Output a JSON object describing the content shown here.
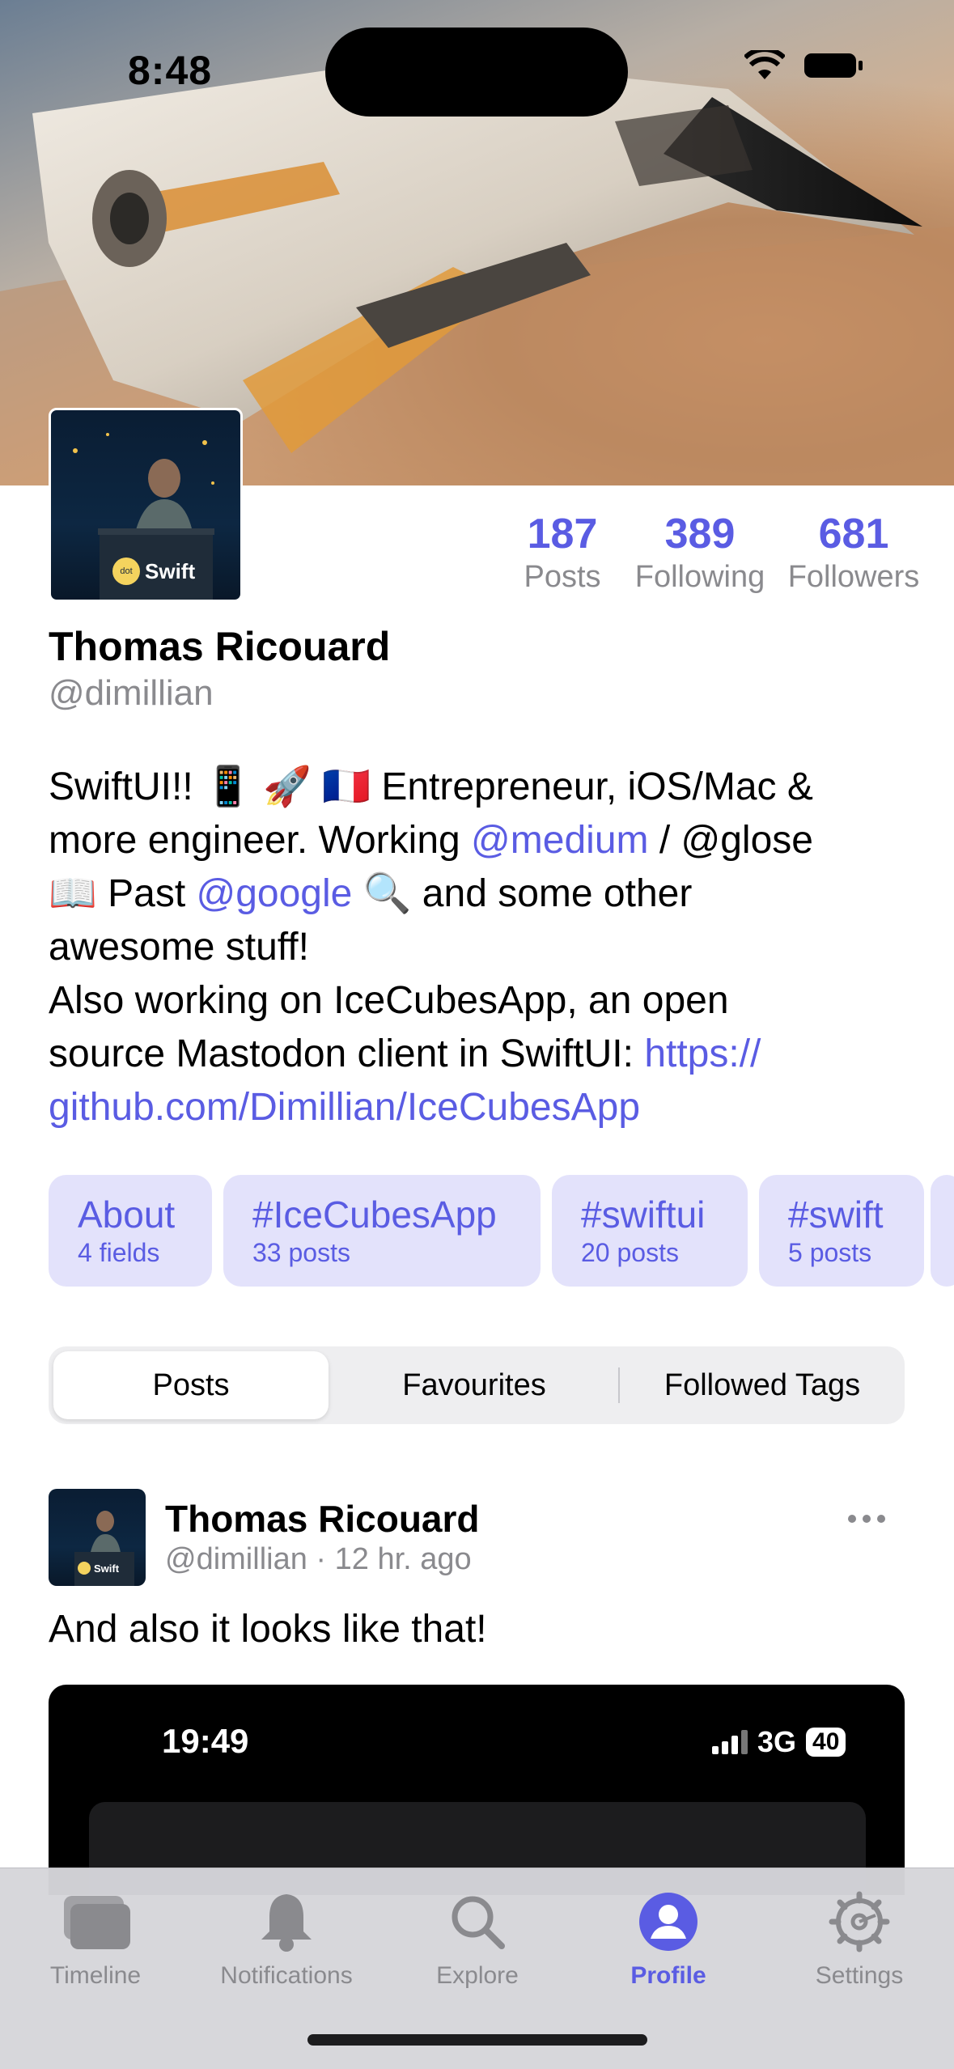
{
  "status_bar": {
    "time": "8:48"
  },
  "profile": {
    "display_name": "Thomas Ricouard",
    "handle": "@dimillian",
    "stats": [
      {
        "value": "187",
        "label": "Posts"
      },
      {
        "value": "389",
        "label": "Following"
      },
      {
        "value": "681",
        "label": "Followers"
      }
    ],
    "bio": {
      "line1": "SwiftUI!! 📱 🚀 🇫🇷 Entrepreneur, iOS/Mac &",
      "line2_pre": "more engineer. Working ",
      "line2_link": "@medium",
      "line2_post": " / @glose",
      "line3_pre": "📖 Past ",
      "line3_link": "@google",
      "line3_post": " 🔍 and some other",
      "line4": "awesome stuff!",
      "line5": "Also working on IceCubesApp, an open",
      "line6_pre": "source Mastodon client in SwiftUI: ",
      "line6_link": "https://",
      "line7_link": "github.com/Dimillian/IceCubesApp"
    },
    "avatar_caption": "Swift",
    "avatar_badge": "dot"
  },
  "chips": [
    {
      "title": "About",
      "subtitle": "4 fields"
    },
    {
      "title": "#IceCubesApp",
      "subtitle": "33 posts"
    },
    {
      "title": "#swiftui",
      "subtitle": "20 posts"
    },
    {
      "title": "#swift",
      "subtitle": "5 posts"
    }
  ],
  "segmented": {
    "options": [
      "Posts",
      "Favourites",
      "Followed Tags"
    ],
    "selected": "Posts"
  },
  "post": {
    "author": "Thomas Ricouard",
    "meta": "@dimillian · 12 hr. ago",
    "text": "And also it looks like that!",
    "media": {
      "time": "19:49",
      "network": "3G",
      "battery": "40"
    }
  },
  "tabbar": {
    "items": [
      {
        "label": "Timeline",
        "icon": "timeline-icon"
      },
      {
        "label": "Notifications",
        "icon": "bell-icon"
      },
      {
        "label": "Explore",
        "icon": "search-icon"
      },
      {
        "label": "Profile",
        "icon": "profile-icon"
      },
      {
        "label": "Settings",
        "icon": "gear-icon"
      }
    ],
    "active": "Profile"
  },
  "colors": {
    "accent": "#5a5ce3",
    "chip_bg": "#e3e2fb",
    "secondary_text": "#8a8a8e"
  }
}
